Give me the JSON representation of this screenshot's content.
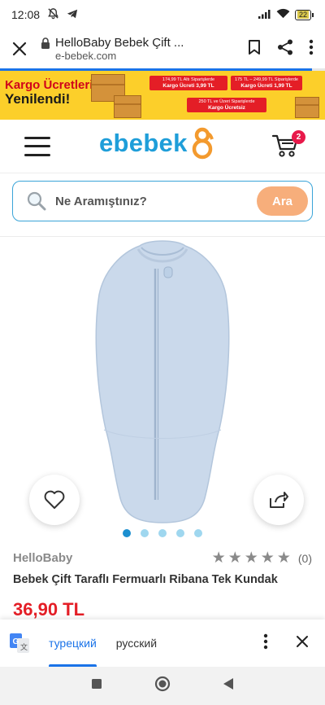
{
  "status_bar": {
    "time": "12:08",
    "battery": "22"
  },
  "browser": {
    "page_title": "HelloBaby Bebek Çift ...",
    "domain": "e-bebek.com",
    "load_progress": 0.96
  },
  "banner": {
    "title_line1": "Kargo Ücretleri",
    "title_line2": "Yenilendi!",
    "promo1_small": "174,99 TL Altı Siparişlerde",
    "promo1_big": "Kargo Ücreti 3,99 TL",
    "promo2_small": "175 TL – 249,99 TL Siparişlerde",
    "promo2_big": "Kargo Ücreti 1,99 TL",
    "promo3_small": "250 TL ve Üzeri Siparişlerde",
    "promo3_big": "Kargo Ücretsiz",
    "colors": {
      "background": "#fccf2a",
      "accent": "#e41e26"
    }
  },
  "header": {
    "logo_text": "ebebek",
    "cart_count": "2",
    "logo_color": "#1f9ed9"
  },
  "search": {
    "placeholder": "Ne Aramıştınız?",
    "button_label": "Ara"
  },
  "carousel": {
    "image_count": 5,
    "active_index": 0
  },
  "product": {
    "brand": "HelloBaby",
    "name": "Bebek Çift Taraflı Fermuarlı Ribana Tek Kundak",
    "price": "36,90 TL",
    "rating_stars": 0,
    "rating_count": "(0)"
  },
  "translate_bar": {
    "active_language": "турецкий",
    "other_language": "русский"
  }
}
